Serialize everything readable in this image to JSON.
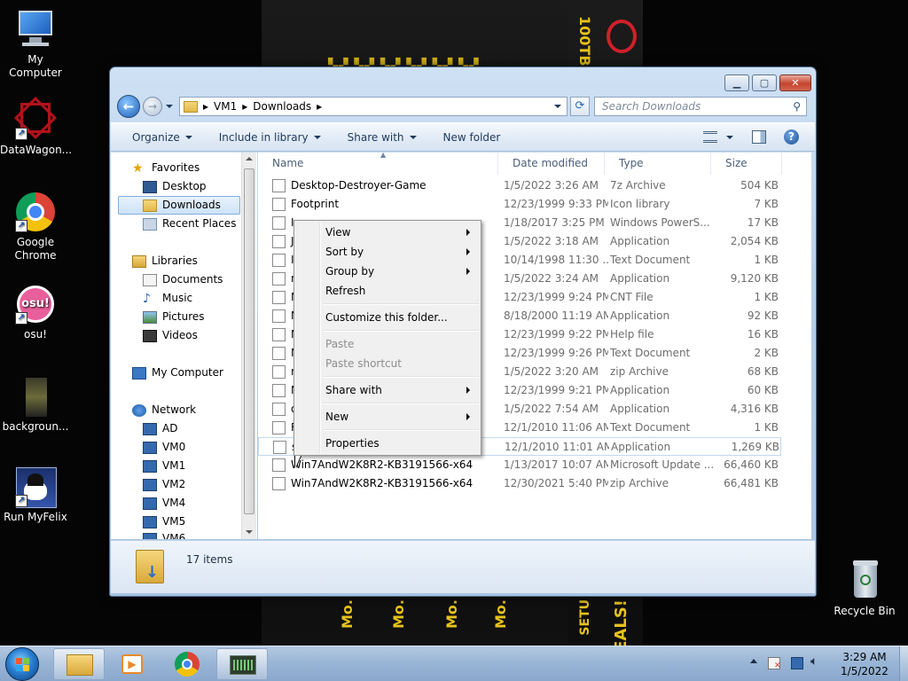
{
  "desktop": {
    "icons": [
      {
        "label": "My Computer"
      },
      {
        "label": "DataWagon..."
      },
      {
        "label": "Google Chrome"
      },
      {
        "label": "osu!"
      },
      {
        "label": "backgroun..."
      },
      {
        "label": "Run MyFelix"
      },
      {
        "label": "Recycle Bin"
      }
    ],
    "wallpaper_text": {
      "top": "100TB",
      "bottom": [
        "Mo.",
        "Mo.",
        "Mo.",
        "Mo.",
        "DEALS!",
        "SETU"
      ]
    }
  },
  "window": {
    "breadcrumb": [
      "VM1",
      "Downloads"
    ],
    "search_placeholder": "Search Downloads",
    "toolbar": {
      "organize": "Organize",
      "include": "Include in library",
      "share": "Share with",
      "new_folder": "New folder"
    },
    "nav": {
      "favorites": "Favorites",
      "desktop": "Desktop",
      "downloads": "Downloads",
      "recent": "Recent Places",
      "libraries": "Libraries",
      "documents": "Documents",
      "music": "Music",
      "pictures": "Pictures",
      "videos": "Videos",
      "computer": "My Computer",
      "network": "Network",
      "hosts": [
        "AD",
        "VM0",
        "VM1",
        "VM2",
        "VM4",
        "VM5",
        "VM6"
      ]
    },
    "columns": {
      "name": "Name",
      "date": "Date modified",
      "type": "Type",
      "size": "Size"
    },
    "files": [
      {
        "name": "Desktop-Destroyer-Game",
        "date": "1/5/2022 3:26 AM",
        "type": "7z Archive",
        "size": "504 KB"
      },
      {
        "name": "Footprint",
        "date": "12/23/1999 9:33 PM",
        "type": "Icon library",
        "size": "7 KB"
      },
      {
        "name": "I",
        "date": "1/18/2017 3:25 PM",
        "type": "Windows PowerS...",
        "size": "17 KB"
      },
      {
        "name": "J",
        "date": "1/5/2022 3:18 AM",
        "type": "Application",
        "size": "2,054 KB"
      },
      {
        "name": "I",
        "date": "10/14/1998 11:30 ...",
        "type": "Text Document",
        "size": "1 KB"
      },
      {
        "name": "n",
        "date": "1/5/2022 3:24 AM",
        "type": "Application",
        "size": "9,120 KB"
      },
      {
        "name": "N",
        "date": "12/23/1999 9:24 PM",
        "type": "CNT File",
        "size": "1 KB"
      },
      {
        "name": "N",
        "date": "8/18/2000 11:19 AM",
        "type": "Application",
        "size": "92 KB"
      },
      {
        "name": "N",
        "date": "12/23/1999 9:22 PM",
        "type": "Help file",
        "size": "16 KB"
      },
      {
        "name": "N",
        "date": "12/23/1999 9:26 PM",
        "type": "Text Document",
        "size": "2 KB"
      },
      {
        "name": "n",
        "date": "1/5/2022 3:20 AM",
        "type": "zip Archive",
        "size": "68 KB"
      },
      {
        "name": "N",
        "date": "12/23/1999 9:21 PM",
        "type": "Application",
        "size": "60 KB"
      },
      {
        "name": "o",
        "date": "1/5/2022 7:54 AM",
        "type": "Application",
        "size": "4,316 KB"
      },
      {
        "name": "F",
        "date": "12/1/2010 11:06 AM",
        "type": "Text Document",
        "size": "1 KB"
      },
      {
        "name": "s",
        "date": "12/1/2010 11:01 AM",
        "type": "Application",
        "size": "1,269 KB"
      },
      {
        "name": "Win7AndW2K8R2-KB3191566-x64",
        "date": "1/13/2017 10:07 AM",
        "type": "Microsoft Update ...",
        "size": "66,460 KB"
      },
      {
        "name": "Win7AndW2K8R2-KB3191566-x64",
        "date": "12/30/2021 5:40 PM",
        "type": "zip Archive",
        "size": "66,481 KB"
      }
    ],
    "status": "17 items"
  },
  "context_menu": {
    "view": "View",
    "sort_by": "Sort by",
    "group_by": "Group by",
    "refresh": "Refresh",
    "customize": "Customize this folder...",
    "paste": "Paste",
    "paste_shortcut": "Paste shortcut",
    "share_with": "Share with",
    "new": "New",
    "properties": "Properties"
  },
  "taskbar": {
    "time": "3:29 AM",
    "date": "1/5/2022"
  }
}
